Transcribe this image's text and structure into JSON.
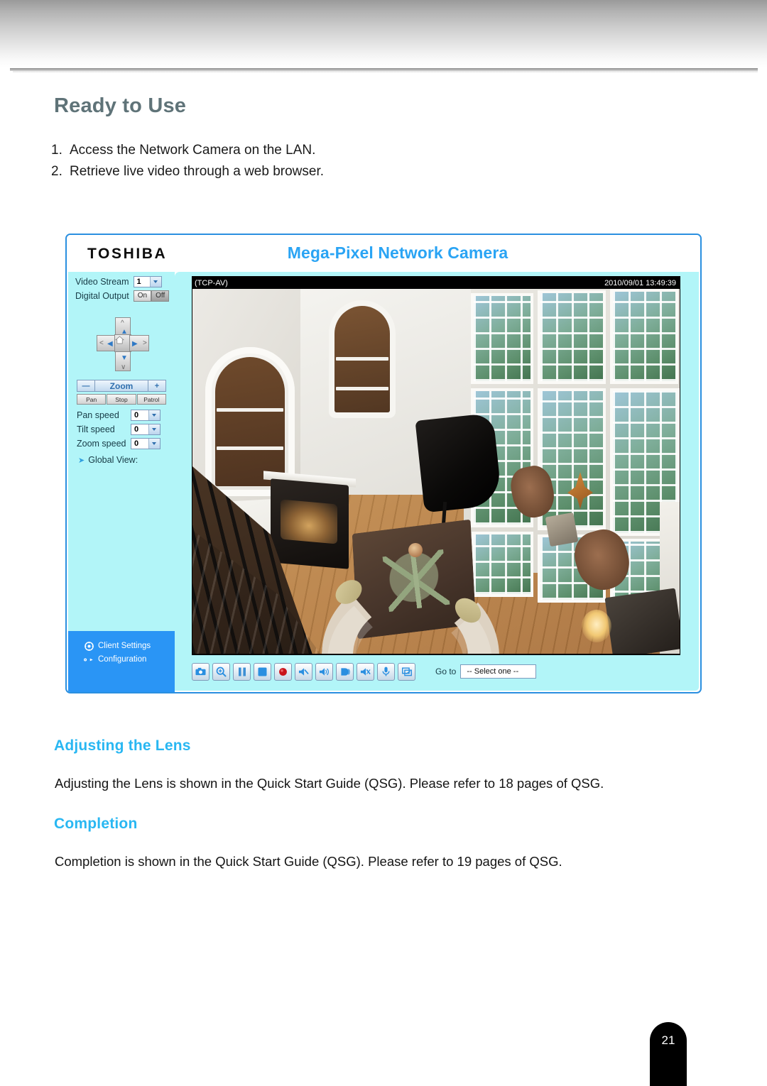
{
  "document": {
    "page_title": "Ready to Use",
    "steps": [
      {
        "num": "1.",
        "text": "Access the Network Camera on the LAN."
      },
      {
        "num": "2.",
        "text": "Retrieve live video through a web browser."
      }
    ],
    "sections": [
      {
        "heading": "Adjusting the Lens",
        "body": "Adjusting the Lens is shown in the Quick Start Guide (QSG). Please refer to 18 pages of QSG."
      },
      {
        "heading": "Completion",
        "body": "Completion is shown in the Quick Start Guide (QSG). Please refer to 19 pages of QSG."
      }
    ],
    "page_number": "21",
    "colors": {
      "title": "#5f7378",
      "section_heading": "#29b7f2",
      "body_text": "#141414"
    }
  },
  "camera_ui": {
    "brand": "TOSHIBA",
    "product_title": "Mega-Pixel Network Camera",
    "accent": "#2aa4f4",
    "panel_bg": "#b2f5f8",
    "menu_bg": "#2a95f5",
    "controls": {
      "video_stream_label": "Video Stream",
      "video_stream_value": "1",
      "digital_output_label": "Digital Output",
      "digital_output_on": "On",
      "digital_output_off": "Off",
      "digital_output_state": "Off",
      "zoom_minus": "—",
      "zoom_label": "Zoom",
      "zoom_plus": "+",
      "pan_button": "Pan",
      "stop_button": "Stop",
      "patrol_button": "Patrol",
      "speeds": [
        {
          "label": "Pan speed",
          "value": "0"
        },
        {
          "label": "Tilt speed",
          "value": "0"
        },
        {
          "label": "Zoom speed",
          "value": "0"
        }
      ],
      "global_view_label": "Global View:"
    },
    "menu": [
      {
        "label": "Client Settings",
        "icon": "gear-icon"
      },
      {
        "label": "Configuration",
        "icon": "wrench-icon"
      }
    ],
    "video": {
      "osd_left": "(TCP-AV)",
      "osd_right": "2010/09/01 13:49:39",
      "scene_description": "Elevated indoor surveillance view of a two-story living room with hardwood floor, curved cream sofa, patterned rug, black grand piano, fireplace, arched built-in shelving and a wall of divided-light windows."
    },
    "toolbar": {
      "buttons": [
        "snapshot-icon",
        "digital-zoom-icon",
        "pause-icon",
        "stop-icon",
        "record-icon",
        "volume-mute-icon",
        "speaker-icon",
        "talk-icon",
        "mic-mute-icon",
        "microphone-icon",
        "full-screen-icon"
      ],
      "goto_label": "Go to",
      "goto_value": "-- Select one --"
    }
  }
}
